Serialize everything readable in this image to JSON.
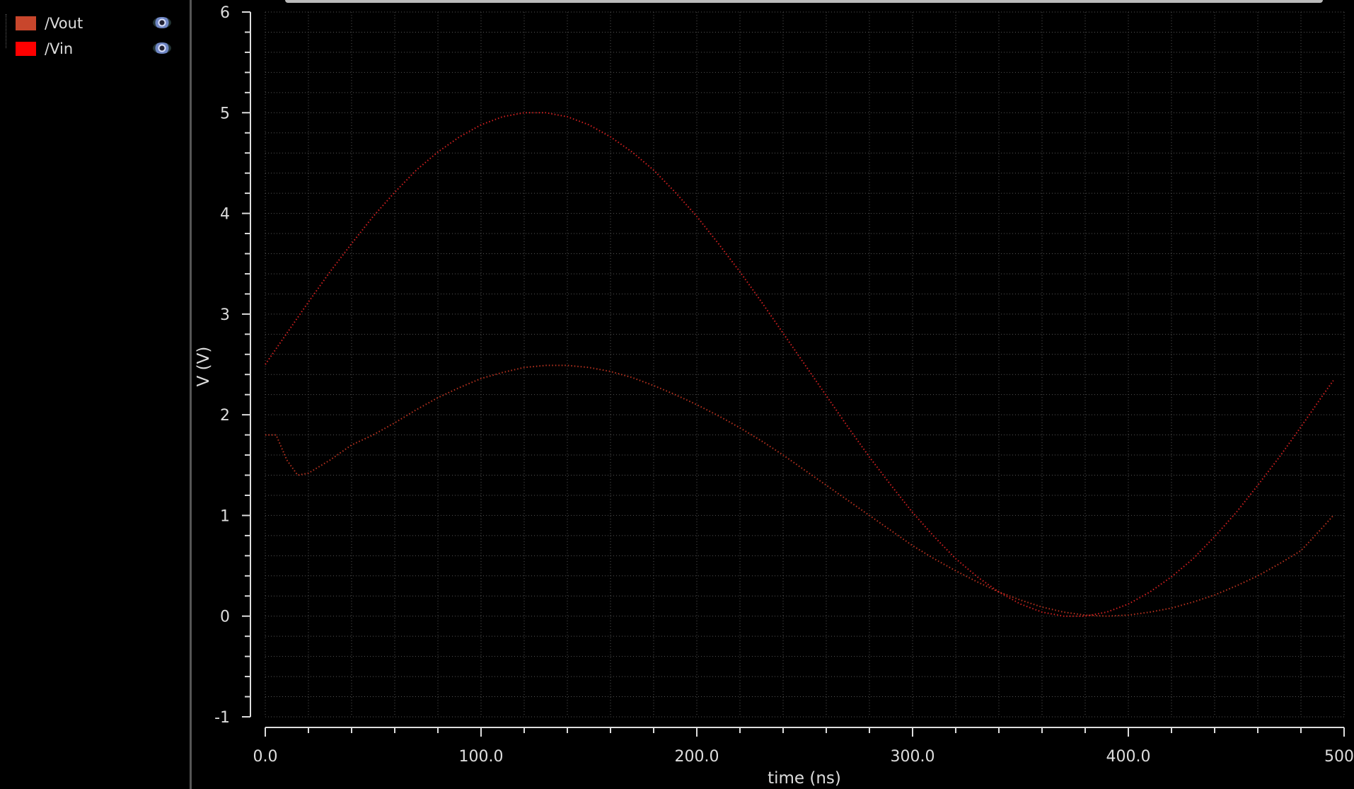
{
  "legend": [
    {
      "name": "/Vout",
      "color": "#c8462c",
      "icon": "eye-icon"
    },
    {
      "name": "/Vin",
      "color": "#ff0000",
      "icon": "eye-icon"
    }
  ],
  "chart_data": {
    "type": "line",
    "xlabel": "time (ns)",
    "ylabel": "V (V)",
    "xlim": [
      0,
      500
    ],
    "ylim": [
      -1,
      6
    ],
    "grid": true,
    "x_ticks": [
      "0.0",
      "100.0",
      "200.0",
      "300.0",
      "400.0",
      "500"
    ],
    "x_tick_values": [
      0,
      100,
      200,
      300,
      400,
      500
    ],
    "y_ticks": [
      "6",
      "5",
      "4",
      "3",
      "2",
      "1",
      "0",
      "-1"
    ],
    "y_tick_values": [
      6,
      5,
      4,
      3,
      2,
      1,
      0,
      -1
    ],
    "series": [
      {
        "name": "/Vout",
        "color": "#b8321f",
        "x": [
          0,
          5,
          10,
          15,
          20,
          30,
          40,
          50,
          60,
          70,
          80,
          90,
          100,
          110,
          120,
          130,
          140,
          150,
          160,
          170,
          180,
          190,
          200,
          210,
          220,
          230,
          240,
          250,
          260,
          270,
          280,
          290,
          300,
          310,
          320,
          330,
          340,
          350,
          360,
          370,
          380,
          390,
          400,
          410,
          420,
          430,
          440,
          450,
          460,
          470,
          480,
          490,
          495
        ],
        "values": [
          1.8,
          1.8,
          1.55,
          1.4,
          1.42,
          1.55,
          1.7,
          1.8,
          1.92,
          2.05,
          2.17,
          2.27,
          2.36,
          2.42,
          2.47,
          2.49,
          2.49,
          2.47,
          2.43,
          2.37,
          2.29,
          2.2,
          2.1,
          1.99,
          1.87,
          1.74,
          1.6,
          1.45,
          1.3,
          1.15,
          1.0,
          0.85,
          0.7,
          0.57,
          0.45,
          0.34,
          0.24,
          0.16,
          0.09,
          0.04,
          0.01,
          0.0,
          0.01,
          0.04,
          0.08,
          0.14,
          0.21,
          0.3,
          0.4,
          0.52,
          0.65,
          0.88,
          1.0
        ]
      },
      {
        "name": "/Vin",
        "color": "#d02020",
        "x": [
          0,
          10,
          20,
          30,
          40,
          50,
          60,
          70,
          80,
          90,
          100,
          110,
          120,
          130,
          140,
          150,
          160,
          170,
          180,
          190,
          200,
          210,
          220,
          230,
          240,
          250,
          260,
          270,
          280,
          290,
          300,
          310,
          320,
          330,
          340,
          350,
          360,
          370,
          380,
          390,
          400,
          410,
          420,
          430,
          440,
          450,
          460,
          470,
          480,
          490,
          495
        ],
        "values": [
          2.5,
          2.81,
          3.12,
          3.42,
          3.7,
          3.97,
          4.21,
          4.43,
          4.61,
          4.76,
          4.88,
          4.96,
          5.0,
          5.0,
          4.96,
          4.88,
          4.76,
          4.61,
          4.43,
          4.21,
          3.97,
          3.7,
          3.42,
          3.12,
          2.81,
          2.5,
          2.19,
          1.88,
          1.58,
          1.3,
          1.03,
          0.79,
          0.57,
          0.39,
          0.24,
          0.12,
          0.04,
          0.0,
          0.0,
          0.04,
          0.12,
          0.24,
          0.39,
          0.57,
          0.79,
          1.03,
          1.3,
          1.58,
          1.88,
          2.19,
          2.34
        ]
      }
    ]
  }
}
